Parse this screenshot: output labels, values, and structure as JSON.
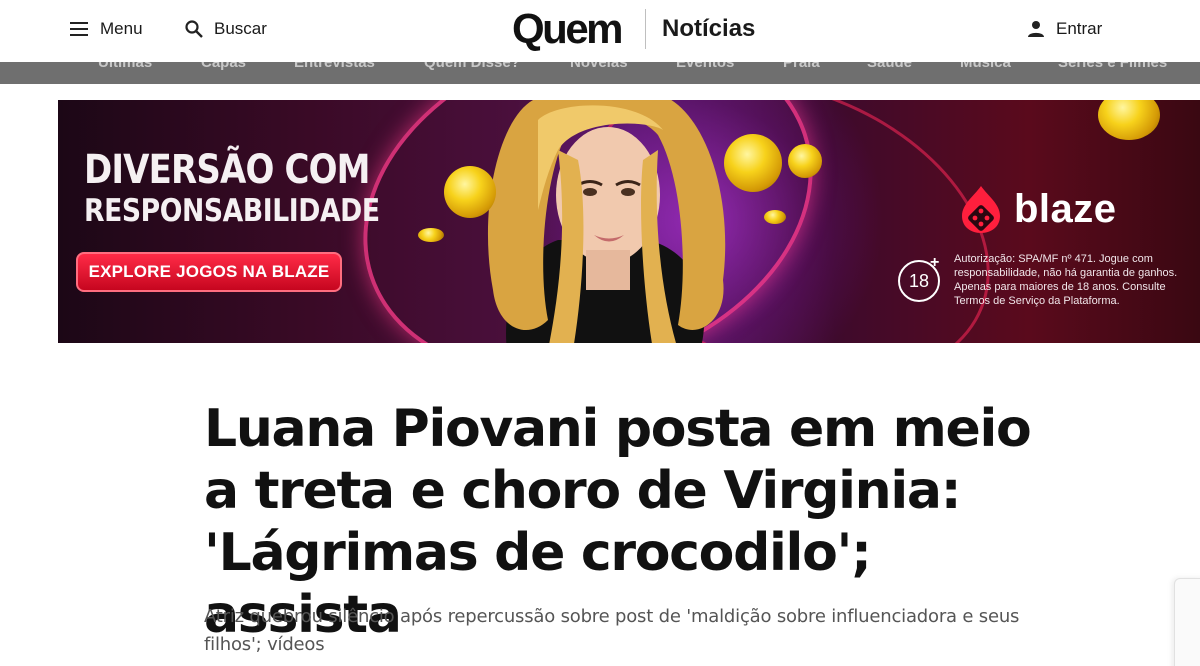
{
  "header": {
    "menu_label": "Menu",
    "search_label": "Buscar",
    "logo_text": "Quem",
    "section_label": "Notícias",
    "login_label": "Entrar"
  },
  "categories": [
    "Últimas",
    "Capas",
    "Entrevistas",
    "Quem Disse?",
    "Novelas",
    "Eventos",
    "Praia",
    "Saúde",
    "Música",
    "Séries e Filmes"
  ],
  "ad": {
    "headline_line1": "DIVERSÃO COM",
    "headline_line2": "RESPONSABILIDADE",
    "cta_label": "EXPLORE JOGOS NA BLAZE",
    "brand": "blaze",
    "age_badge": "18",
    "age_plus": "+",
    "legal_text": "Autorização: SPA/MF nº 471. Jogue com responsabilidade, não há garantia de ganhos. Apenas para maiores de 18 anos. Consulte Termos de Serviço da Plataforma.",
    "colors": {
      "cta": "#e0102e",
      "brand_red": "#ff1f3d",
      "glow": "#ff3c8c"
    }
  },
  "article": {
    "title": "Luana Piovani posta em meio a treta e choro de Virginia: 'Lágrimas de crocodilo'; assista",
    "subtitle": "Atriz quebrou silêncio após repercussão sobre post de 'maldição sobre influenciadora e seus filhos'; vídeos"
  },
  "icons": [
    "menu-icon",
    "search-icon",
    "user-icon",
    "blaze-logo-icon"
  ]
}
